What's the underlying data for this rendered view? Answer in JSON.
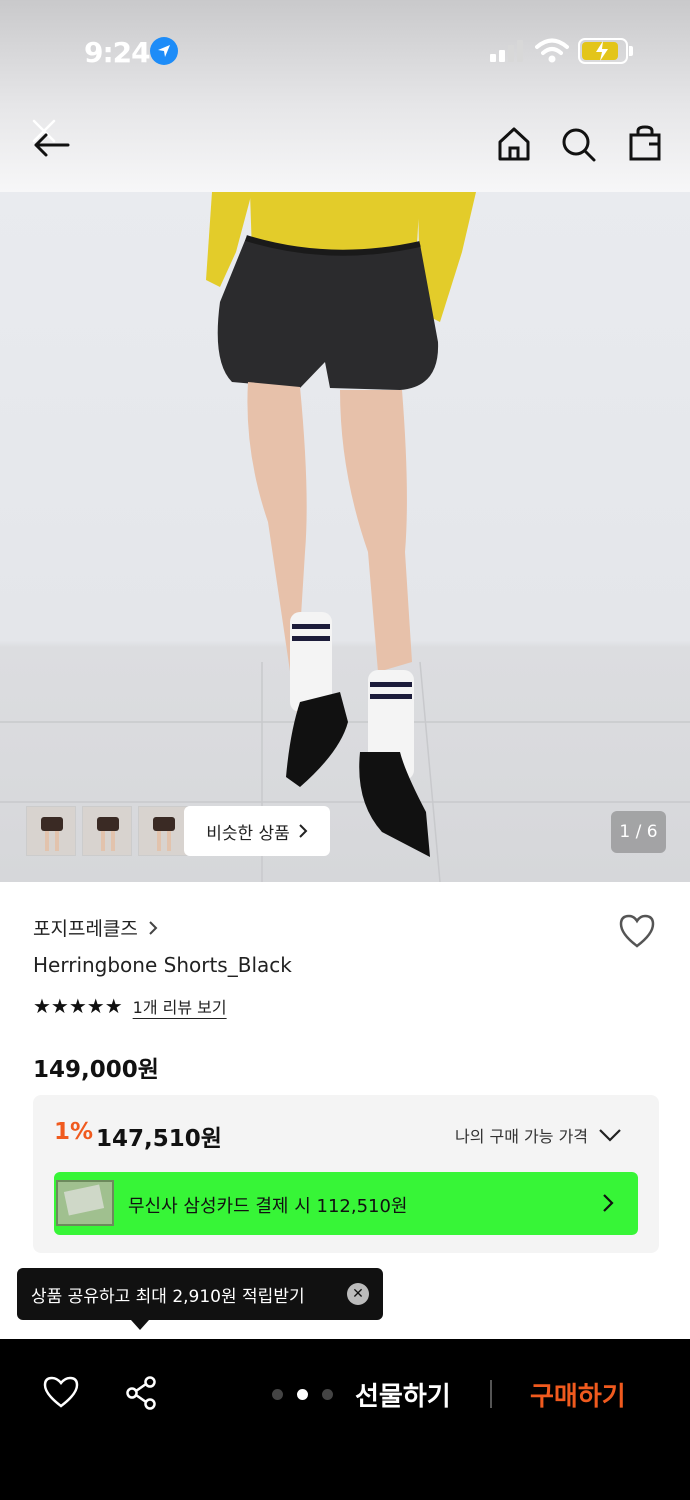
{
  "status_bar": {
    "time": "9:24"
  },
  "hero": {
    "similar_label": "비슷한 상품",
    "page_indicator": "1 / 6"
  },
  "product": {
    "brand": "포지프레클즈",
    "name": "Herringbone Shorts_Black",
    "stars": "★★★★★",
    "rating": 5,
    "review_link": "1개 리뷰 보기",
    "price": "149,000원"
  },
  "price_box": {
    "discount": "1%",
    "discounted_price": "147,510원",
    "my_price_label": "나의 구매 가능 가격",
    "card_promo": "무신사 삼성카드 결제 시 112,510원"
  },
  "tooltip": {
    "text": "상품 공유하고 최대 2,910원 적립받기"
  },
  "bottom_bar": {
    "gift_label": "선물하기",
    "buy_label": "구매하기"
  },
  "colors": {
    "accent": "#f05a1e",
    "promo_green": "#37f537"
  }
}
